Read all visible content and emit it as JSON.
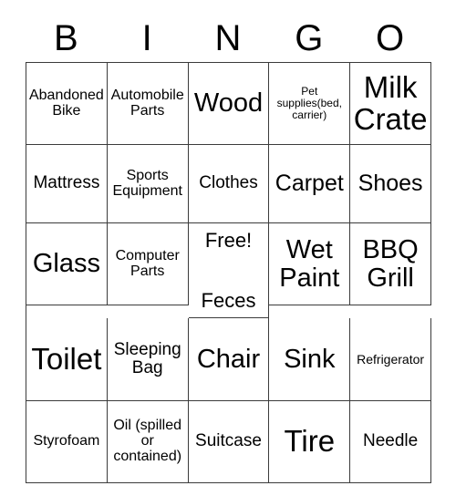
{
  "card": {
    "title": "BINGO",
    "header_letters": [
      "B",
      "I",
      "N",
      "G",
      "O"
    ],
    "rows": [
      [
        {
          "text": "Abandoned Bike",
          "size": "sm"
        },
        {
          "text": "Automobile Parts",
          "size": "sm"
        },
        {
          "text": "Wood",
          "size": "xl"
        },
        {
          "text": "Pet supplies(bed, carrier)",
          "size": "xxs"
        },
        {
          "text": "Milk Crate",
          "size": "xxl"
        }
      ],
      [
        {
          "text": "Mattress",
          "size": "md"
        },
        {
          "text": "Sports Equipment",
          "size": "sm"
        },
        {
          "text": "Clothes",
          "size": "md"
        },
        {
          "text": "Carpet",
          "size": "lg"
        },
        {
          "text": "Shoes",
          "size": "lg"
        }
      ],
      [
        {
          "text": "Glass",
          "size": "xl"
        },
        {
          "text": "Computer Parts",
          "size": "sm"
        },
        {
          "text": "Feces",
          "size": "free",
          "free_label": "Free!"
        },
        {
          "text": "Wet Paint",
          "size": "xl"
        },
        {
          "text": "BBQ Grill",
          "size": "xl"
        }
      ],
      [
        {
          "text": "Toilet",
          "size": "xxl"
        },
        {
          "text": "Sleeping Bag",
          "size": "md"
        },
        {
          "text": "Chair",
          "size": "xl"
        },
        {
          "text": "Sink",
          "size": "xl"
        },
        {
          "text": "Refrigerator",
          "size": "xs"
        }
      ],
      [
        {
          "text": "Styrofoam",
          "size": "sm"
        },
        {
          "text": "Oil (spilled or contained)",
          "size": "sm"
        },
        {
          "text": "Suitcase",
          "size": "md"
        },
        {
          "text": "Tire",
          "size": "xxl"
        },
        {
          "text": "Needle",
          "size": "md"
        }
      ]
    ],
    "colors": {
      "text": "#000000",
      "border": "#3b3b3b",
      "background": "#ffffff"
    }
  }
}
